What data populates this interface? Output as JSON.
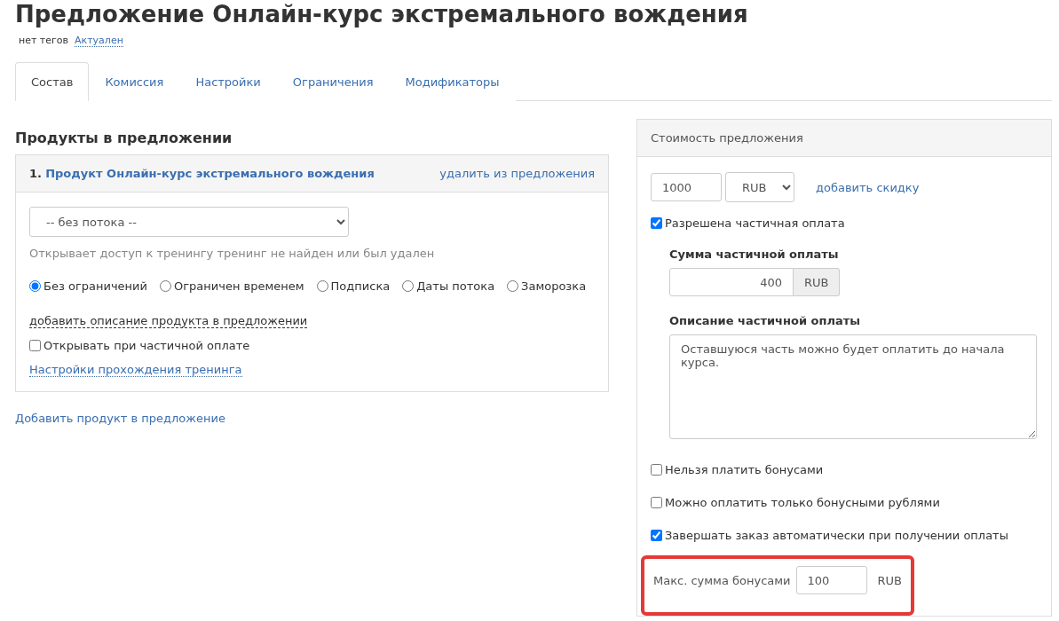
{
  "title": "Предложение Онлайн-курс экстремального вождения",
  "meta": {
    "tags": "нет тегов",
    "status": "Актуален"
  },
  "tabs": [
    {
      "label": "Состав",
      "selected": true
    },
    {
      "label": "Комиссия",
      "selected": false
    },
    {
      "label": "Настройки",
      "selected": false
    },
    {
      "label": "Ограничения",
      "selected": false
    },
    {
      "label": "Модификаторы",
      "selected": false
    }
  ],
  "products": {
    "heading": "Продукты в предложении",
    "items": [
      {
        "number": "1.",
        "name": "Продукт Онлайн-курс экстремального вождения",
        "remove": "удалить из предложения",
        "stream": "-- без потока --",
        "access_note": "Открывает доступ к тренингу тренинг не найден или был удален",
        "access_options": [
          {
            "label": "Без ограничений",
            "selected": true
          },
          {
            "label": "Ограничен временем",
            "selected": false
          },
          {
            "label": "Подписка",
            "selected": false
          },
          {
            "label": "Даты потока",
            "selected": false
          },
          {
            "label": "Заморозка",
            "selected": false
          }
        ],
        "add_description": "добавить описание продукта в предложении",
        "open_on_partial": {
          "label": "Открывать при частичной оплате",
          "checked": false
        },
        "training_settings": "Настройки прохождения тренинга"
      }
    ],
    "add_product": "Добавить продукт в предложение"
  },
  "price": {
    "heading": "Стоимость предложения",
    "amount": "1000",
    "currency": "RUB",
    "add_discount": "добавить скидку",
    "partial": {
      "label": "Разрешена частичная оплата",
      "checked": true
    },
    "partial_sum": {
      "label": "Сумма частичной оплаты",
      "value": "400",
      "unit": "RUB"
    },
    "partial_description": {
      "label": "Описание частичной оплаты",
      "value": "Оставшуюся часть можно будет оплатить до начала курса."
    },
    "options": [
      {
        "label": "Нельзя платить бонусами",
        "checked": false
      },
      {
        "label": "Можно оплатить только бонусными рублями",
        "checked": false
      },
      {
        "label": "Завершать заказ автоматически при получении оплаты",
        "checked": true
      }
    ],
    "max_bonus": {
      "label": "Макс. сумма бонусами",
      "value": "100",
      "unit": "RUB",
      "highlighted": true
    }
  }
}
